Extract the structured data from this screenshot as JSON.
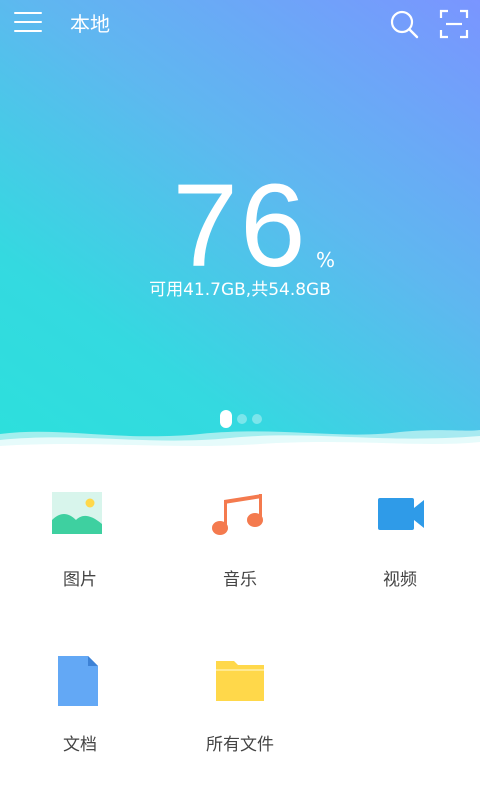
{
  "header": {
    "title": "本地",
    "icons": [
      "menu-icon",
      "search-icon",
      "scan-icon"
    ]
  },
  "storage": {
    "percent": "76",
    "percent_sign": "%",
    "summary": "可用41.7GB,共54.8GB"
  },
  "pager": {
    "pages": 3,
    "active_index": 0
  },
  "categories": [
    {
      "label": "图片",
      "icon": "image-icon"
    },
    {
      "label": "音乐",
      "icon": "music-icon"
    },
    {
      "label": "视频",
      "icon": "video-icon"
    },
    {
      "label": "文档",
      "icon": "document-icon"
    },
    {
      "label": "所有文件",
      "icon": "folder-icon"
    }
  ],
  "colors": {
    "gradient_top": "#7a95ff",
    "gradient_bottom": "#2ce0dc",
    "image_green": "#3ed0a0",
    "music_orange": "#f47a4e",
    "video_blue": "#2f9be8",
    "doc_blue": "#63a8f5",
    "folder_yellow": "#ffd84a"
  }
}
